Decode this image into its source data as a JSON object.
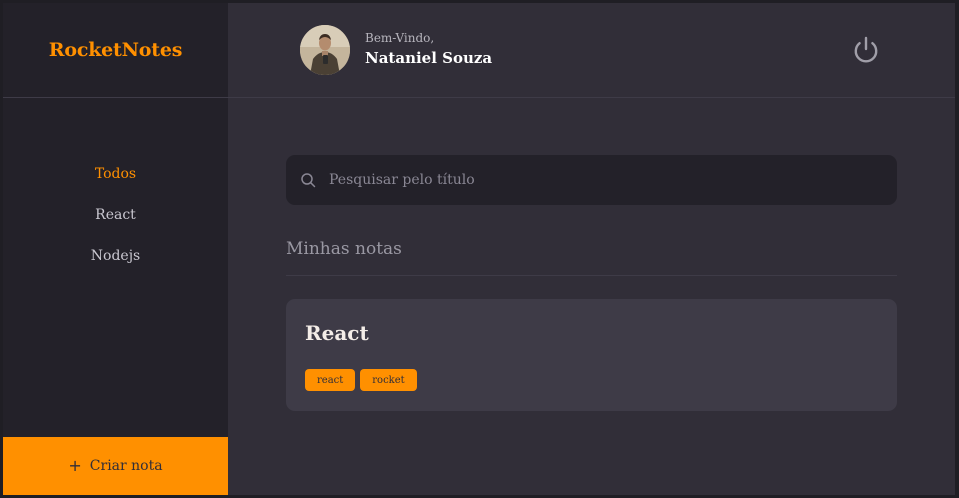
{
  "app": {
    "brand": "RocketNotes"
  },
  "sidebar": {
    "items": [
      {
        "label": "Todos",
        "active": true
      },
      {
        "label": "React",
        "active": false
      },
      {
        "label": "Nodejs",
        "active": false
      }
    ],
    "create_button": {
      "icon": "plus-icon",
      "label": "Criar nota"
    }
  },
  "header": {
    "greeting": "Bem-Vindo,",
    "user_name": "Nataniel Souza",
    "avatar_icon": "user-avatar",
    "logout_icon": "power-icon"
  },
  "search": {
    "icon": "search-icon",
    "placeholder": "Pesquisar pelo título",
    "value": ""
  },
  "notes_section": {
    "title": "Minhas notas",
    "notes": [
      {
        "title": "React",
        "tags": [
          "react",
          "rocket"
        ]
      }
    ]
  },
  "colors": {
    "accent": "#ff9000",
    "background": "#312e38",
    "sidebar": "#232129",
    "card": "#3e3b47"
  }
}
